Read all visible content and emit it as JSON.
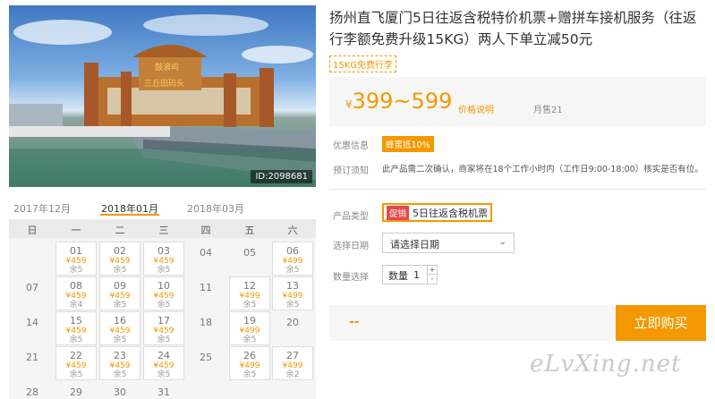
{
  "photo": {
    "id_label": "ID:2098681",
    "sign_top": "鼓浪屿",
    "sign_bottom": "三丘田码头"
  },
  "calendar": {
    "months": [
      "2017年12月",
      "2018年01月",
      "2018年03月"
    ],
    "active_month": "2018年01月",
    "weekdays": [
      "日",
      "一",
      "二",
      "三",
      "四",
      "五",
      "六"
    ],
    "rows": [
      [
        null,
        {
          "d": "01",
          "p": "¥459",
          "r": "余5"
        },
        {
          "d": "02",
          "p": "¥459",
          "r": "余5"
        },
        {
          "d": "03",
          "p": "¥459",
          "r": "余5"
        },
        {
          "d": "04"
        },
        {
          "d": "05"
        },
        {
          "d": "06",
          "p": "¥499",
          "r": "余5"
        }
      ],
      [
        {
          "d": "07"
        },
        {
          "d": "08",
          "p": "¥459",
          "r": "余4"
        },
        {
          "d": "09",
          "p": "¥459",
          "r": "余5"
        },
        {
          "d": "10",
          "p": "¥459",
          "r": "余5"
        },
        {
          "d": "11"
        },
        {
          "d": "12",
          "p": "¥499",
          "r": "余5"
        },
        {
          "d": "13",
          "p": "¥499",
          "r": "余5"
        }
      ],
      [
        {
          "d": "14"
        },
        {
          "d": "15",
          "p": "¥459",
          "r": "余5"
        },
        {
          "d": "16",
          "p": "¥459",
          "r": "余5"
        },
        {
          "d": "17",
          "p": "¥459",
          "r": "余5"
        },
        {
          "d": "18"
        },
        {
          "d": "19",
          "p": "¥499",
          "r": "余5"
        },
        {
          "d": "20"
        }
      ],
      [
        {
          "d": "21"
        },
        {
          "d": "22",
          "p": "¥459",
          "r": "余5"
        },
        {
          "d": "23",
          "p": "¥459",
          "r": "余5"
        },
        {
          "d": "24",
          "p": "¥459",
          "r": "余5"
        },
        {
          "d": "25"
        },
        {
          "d": "26",
          "p": "¥499",
          "r": "余5"
        },
        {
          "d": "27",
          "p": "¥499",
          "r": "余2"
        }
      ],
      [
        {
          "d": "28"
        },
        {
          "d": "29"
        },
        {
          "d": "30"
        },
        {
          "d": "31"
        },
        null,
        null,
        null
      ]
    ]
  },
  "product": {
    "title": "扬州直飞厦门5日往返含税特价机票+赠拼车接机服务（往返行李额免费升级15KG）两人下单立减50元",
    "baggage_tag": "15KG免费行李",
    "price_currency": "¥",
    "price_range": "399~599",
    "price_note": "价格说明",
    "monthly_sales": "月售21",
    "coupon_label": "优惠信息",
    "coupon_tag": "蜂蜜抵10%",
    "notice_label": "预订须知",
    "notice_text": "此产品需二次确认，商家将在18个工作小时内（工作日9:00-18:00）核实是否有位。",
    "type_label": "产品类型",
    "type_promo": "促销",
    "type_value": "5日往返含税机票",
    "date_label": "选择日期",
    "date_placeholder": "请选择日期",
    "qty_label": "数量选择",
    "qty_unit": "数量",
    "qty_value": "1",
    "qty_plus": "+",
    "qty_minus": "-",
    "total_price": "--",
    "buy_label": "立即购买"
  },
  "watermark": "eLvXing.net",
  "colors": {
    "accent": "#f39800",
    "promo": "#e5484d"
  }
}
